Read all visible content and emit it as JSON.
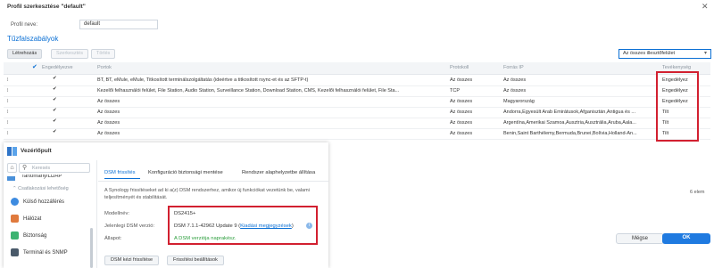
{
  "window": {
    "title": "Profil szerkesztése \"default\""
  },
  "profile": {
    "name_label": "Profil neve:",
    "name_value": "default"
  },
  "section_title": "Tűzfalszabályok",
  "toolbar": {
    "create": "Létrehozás",
    "edit": "Szerkesztés",
    "delete": "Törlés"
  },
  "filter": {
    "selected": "Az összes illesztőfelület"
  },
  "table": {
    "headers": [
      "Engedélyezve",
      "Portok",
      "Protokoll",
      "Forrás IP",
      "Tevékenység"
    ],
    "rows": [
      {
        "ports": "BT, BT, eMule, eMule, Titkosított terminálszolgáltatás (ideértve a titkosított rsync-et és az SFTP-t)",
        "protocol": "Az összes",
        "source": "Az összes",
        "action": "Engedélyez"
      },
      {
        "ports": "Kezelői felhasználói felület, File Station, Audio Station, Surveillance Station, Download Station, CMS, Kezelői felhasználói felület, File Sta...",
        "protocol": "TCP",
        "source": "Az összes",
        "action": "Engedélyez"
      },
      {
        "ports": "Az összes",
        "protocol": "Az összes",
        "source": "Magyarország",
        "action": "Engedélyez"
      },
      {
        "ports": "Az összes",
        "protocol": "Az összes",
        "source": "Andorra,Egyesült Arab Emirátusok,Afganisztán,Antigua és ...",
        "action": "Tilt"
      },
      {
        "ports": "Az összes",
        "protocol": "Az összes",
        "source": "Argentína,Amerikai Szamoa,Ausztria,Ausztrália,Aruba,Åala...",
        "action": "Tilt"
      },
      {
        "ports": "Az összes",
        "protocol": "Az összes",
        "source": "Benin,Saint Barthélemy,Bermuda,Brunei,Bolívia,Holland-An...",
        "action": "Tilt"
      }
    ]
  },
  "item_count": "6 elem",
  "footer": {
    "cancel": "Mégse",
    "ok": "OK"
  },
  "control_panel": {
    "title": "Vezérlőpult",
    "search_placeholder": "Keresés",
    "truncated_item": "Tartomány/LDAP",
    "group_label": "Csatlakozási lehetőség",
    "sidebar": [
      "Külső hozzáférés",
      "Hálózat",
      "Biztonság",
      "Terminál és SNMP"
    ],
    "tabs": [
      "DSM frissítés",
      "Konfiguráció biztonsági mentése",
      "Rendszer alaphelyzetbe állítása"
    ],
    "description_line1": "A Synology frissítéseket ad ki a(z) DSM rendszerhez, amikor új funkciókat vezetünk be, valami",
    "description_line2": "teljesítményét és stabilitását.",
    "model_label": "Modellnév:",
    "model_value": "DS2415+",
    "version_label": "Jelenlegi DSM verzió:",
    "version_value": "DSM 7.1.1-42962 Update 9 (",
    "version_link": "Kiadási megjegyzések",
    "version_close": ")",
    "status_label": "Állapot:",
    "status_value": "A DSM verziója naprakész.",
    "manual_update": "DSM kézi frissítése",
    "update_settings": "Frissítési beállítások"
  }
}
